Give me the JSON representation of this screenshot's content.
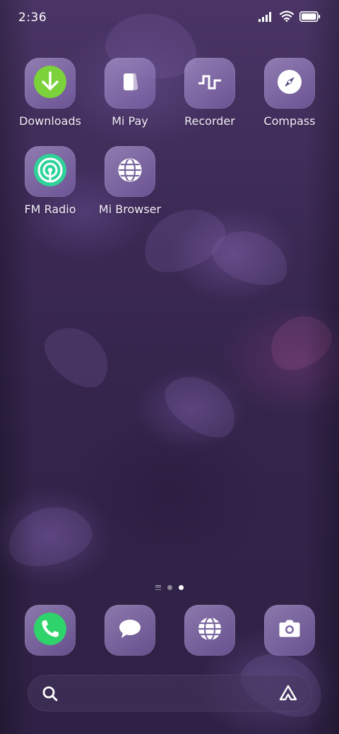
{
  "status_bar": {
    "time": "2:36",
    "icons": [
      "signal-icon",
      "wifi-icon",
      "battery-icon"
    ]
  },
  "home_apps": [
    {
      "label": "Downloads",
      "icon": "download-arrow-icon",
      "icon_color": "#7bd23a"
    },
    {
      "label": "Mi Pay",
      "icon": "card-icon"
    },
    {
      "label": "Recorder",
      "icon": "waveform-icon"
    },
    {
      "label": "Compass",
      "icon": "compass-icon"
    },
    {
      "label": "FM Radio",
      "icon": "radio-broadcast-icon",
      "icon_color": "#2fd39a"
    },
    {
      "label": "Mi Browser",
      "icon": "globe-icon"
    }
  ],
  "page_indicator": {
    "pages": 2,
    "active_page": 2
  },
  "dock": [
    {
      "icon": "phone-icon",
      "icon_color": "#2fd36b"
    },
    {
      "icon": "message-bubble-icon"
    },
    {
      "icon": "globe-icon"
    },
    {
      "icon": "camera-icon"
    }
  ],
  "search_bar": {
    "lead_icon": "search-icon",
    "trail_icon": "assistant-icon"
  },
  "colors": {
    "wallpaper": "#3a2853",
    "icon_tile": "#9a84c2",
    "label": "#f3eefa"
  }
}
